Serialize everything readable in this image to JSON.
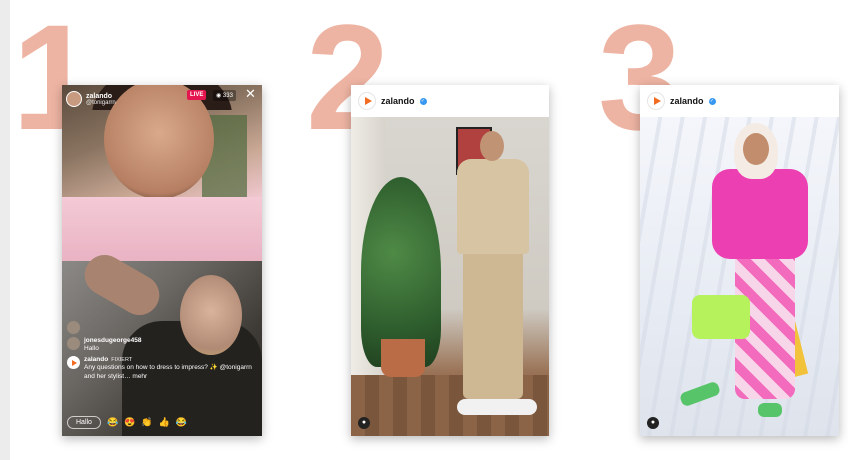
{
  "numbers": [
    "1",
    "2",
    "3"
  ],
  "live": {
    "username": "zalando",
    "handle": "@tonigarrn",
    "live_badge": "LIVE",
    "viewers": "333",
    "close_icon": "close-icon",
    "comments": [
      {
        "name": "",
        "text": ""
      },
      {
        "name": "jonesdugeorge458",
        "text": "Hallo"
      },
      {
        "name": "zalando",
        "pinned": "FIXIERT",
        "text": "Any questions on how to dress to impress? ✨ @tonigarrn and her stylist… mehr"
      }
    ],
    "reply_chip": "Hallo",
    "emojis": [
      "😂",
      "😍",
      "👏",
      "👍",
      "😂"
    ]
  },
  "post2": {
    "brand": "zalando"
  },
  "post3": {
    "brand": "zalando"
  },
  "colors": {
    "accent": "#f26b21",
    "numbers": "#eeb4a3",
    "live": "#e4154f"
  }
}
